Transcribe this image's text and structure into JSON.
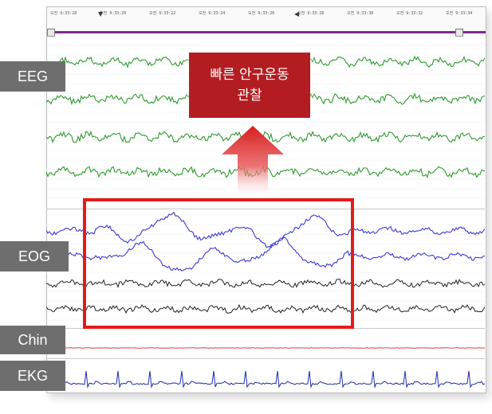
{
  "timeline": {
    "ticks": [
      "오전 9:33:18",
      "오전 9:33:20",
      "오전 9:33:22",
      "오전 9:33:24",
      "오전 9:33:26",
      "오전 9:33:28",
      "오전 9:33:30",
      "오전 9:33:32",
      "오전 9:33:34"
    ]
  },
  "channels": {
    "eeg": "EEG",
    "eog": "EOG",
    "chin": "Chin",
    "ekg": "EKG"
  },
  "callout": {
    "line1": "빠른 안구운동",
    "line2": "관찰"
  },
  "colors": {
    "eeg": "#2e9a2e",
    "eog": "#3a3ad8",
    "eog_secondary": "#222222",
    "chin": "#e0403a",
    "ekg": "#1e2aa8",
    "callout": "#b31d22",
    "highlight": "#e41b1b",
    "label_bg": "#6e6e6e"
  }
}
